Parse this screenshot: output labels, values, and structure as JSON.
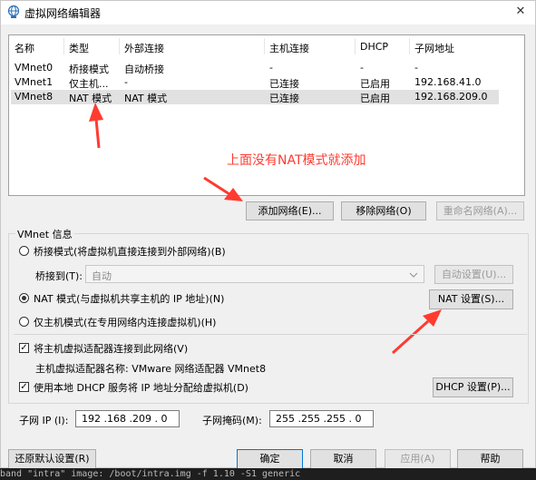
{
  "window": {
    "title": "虚拟网络编辑器",
    "close_label": "✕"
  },
  "table": {
    "headers": [
      "名称",
      "类型",
      "外部连接",
      "主机连接",
      "DHCP",
      "子网地址"
    ],
    "rows": [
      [
        "VMnet0",
        "桥接模式",
        "自动桥接",
        "-",
        "-",
        "-"
      ],
      [
        "VMnet1",
        "仅主机...",
        "-",
        "已连接",
        "已启用",
        "192.168.41.0"
      ],
      [
        "VMnet8",
        "NAT 模式",
        "NAT 模式",
        "已连接",
        "已启用",
        "192.168.209.0"
      ]
    ],
    "selected_row": 2
  },
  "list_buttons": {
    "add": "添加网络(E)...",
    "remove": "移除网络(O)",
    "rename": "重命名网络(A)..."
  },
  "annotation": {
    "text": "上面没有NAT模式就添加",
    "color": "#ff3b30"
  },
  "vmnet_info": {
    "legend": "VMnet 信息",
    "radio_bridge": "桥接模式(将虚拟机直接连接到外部网络)(B)",
    "bridge_to_label": "桥接到(T):",
    "bridge_to_value": "自动",
    "auto_settings": "自动设置(U)...",
    "radio_nat": "NAT 模式(与虚拟机共享主机的 IP 地址)(N)",
    "nat_settings": "NAT 设置(S)...",
    "radio_hostonly": "仅主机模式(在专用网络内连接虚拟机)(H)",
    "selected_mode": "nat",
    "check_connect_adapter": "将主机虚拟适配器连接到此网络(V)",
    "adapter_name": "主机虚拟适配器名称: VMware 网络适配器 VMnet8",
    "check_dhcp": "使用本地 DHCP 服务将 IP 地址分配给虚拟机(D)",
    "dhcp_settings": "DHCP 设置(P)...",
    "subnet_ip_label": "子网 IP (I):",
    "subnet_ip_value": "192 .168 .209 . 0",
    "subnet_mask_label": "子网掩码(M):",
    "subnet_mask_value": "255 .255 .255 . 0"
  },
  "footer": {
    "restore": "还原默认设置(R)",
    "ok": "确定",
    "cancel": "取消",
    "apply": "应用(A)",
    "help": "帮助"
  },
  "bottom_strip_text": "band \"intra\" image: /boot/intra.img -f 1.10 -S1 generic"
}
